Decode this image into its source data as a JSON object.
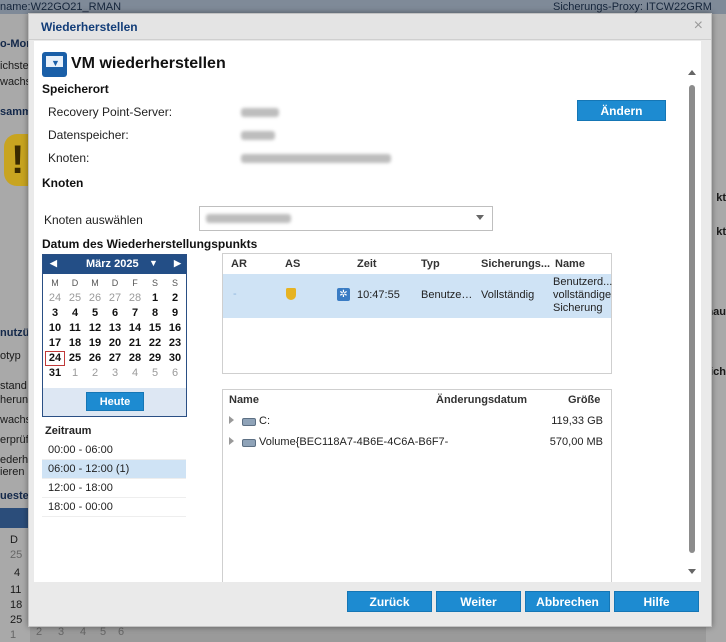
{
  "background": {
    "top_left": "name:W22GO21_RMAN",
    "top_right": "Sicherungs-Proxy: ITCW22GRM",
    "left_texts": [
      "o-Mon",
      "ichste",
      "wachs",
      "samm",
      "nutzül",
      "otyp",
      "stand",
      "herung",
      "wachs",
      "erprüf",
      "ederhe",
      "ieren",
      "ueste"
    ],
    "left_cal": [
      "D",
      "25",
      "4",
      "11",
      "18",
      "25",
      "1"
    ],
    "bottom_row": [
      "2",
      "3",
      "4",
      "5",
      "6"
    ],
    "right_texts": [
      "kt",
      "kt",
      "hau",
      "ich"
    ]
  },
  "dialog": {
    "title": "Wiederherstellen",
    "close": "×",
    "heading": "VM wiederherstellen",
    "speicherort": {
      "title": "Speicherort",
      "labels": [
        "Recovery Point-Server:",
        "Datenspeicher:",
        "Knoten:"
      ],
      "change_button": "Ändern"
    },
    "knoten": {
      "title": "Knoten",
      "select_label": "Knoten auswählen"
    },
    "datum": {
      "title": "Datum des Wiederherstellungspunkts",
      "month": "März 2025",
      "dow": [
        "M",
        "D",
        "M",
        "D",
        "F",
        "S",
        "S"
      ],
      "weeks": [
        [
          "24",
          "25",
          "26",
          "27",
          "28",
          "1",
          "2"
        ],
        [
          "3",
          "4",
          "5",
          "6",
          "7",
          "8",
          "9"
        ],
        [
          "10",
          "11",
          "12",
          "13",
          "14",
          "15",
          "16"
        ],
        [
          "17",
          "18",
          "19",
          "20",
          "21",
          "22",
          "23"
        ],
        [
          "24",
          "25",
          "26",
          "27",
          "28",
          "29",
          "30"
        ],
        [
          "31",
          "1",
          "2",
          "3",
          "4",
          "5",
          "6"
        ]
      ],
      "today_button": "Heute"
    },
    "zeitraum": {
      "title": "Zeitraum",
      "items": [
        "00:00 - 06:00",
        "06:00 - 12:00   (1)",
        "12:00 - 18:00",
        "18:00 - 00:00"
      ]
    },
    "recovery_points": {
      "headers": [
        "AR",
        "AS",
        "Zeit",
        "Typ",
        "Sicherungs...",
        "Name"
      ],
      "rows": [
        {
          "ar": "-",
          "time": "10:47:55",
          "type": "Benutze…",
          "backup": "Vollständig",
          "name": [
            "Benutzerd...",
            "vollständige",
            "Sicherung"
          ]
        }
      ]
    },
    "files": {
      "headers": [
        "Name",
        "Änderungsdatum",
        "Größe"
      ],
      "rows": [
        {
          "name": "C:",
          "size": "119,33 GB"
        },
        {
          "name": "Volume{BEC118A7-4B6E-4C6A-B6F7-",
          "size": "570,00 MB"
        }
      ]
    },
    "buttons": {
      "back": "Zurück",
      "next": "Weiter",
      "cancel": "Abbrechen",
      "help": "Hilfe"
    }
  },
  "colors": {
    "accent": "#1d8bd1",
    "header": "#234e86",
    "selection": "#cfe3f5"
  }
}
